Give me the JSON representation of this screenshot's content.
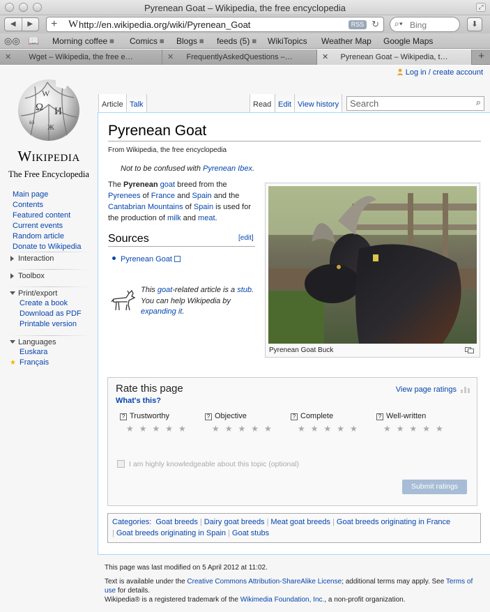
{
  "window": {
    "title": "Pyrenean Goat – Wikipedia, the free encyclopedia"
  },
  "toolbar": {
    "url": "http://en.wikipedia.org/wiki/Pyrenean_Goat",
    "rss_label": "RSS",
    "search_placeholder": "Bing"
  },
  "bookmarks": [
    {
      "label": "Morning coffee",
      "folder": true
    },
    {
      "label": "Comics",
      "folder": true
    },
    {
      "label": "Blogs",
      "folder": true
    },
    {
      "label": "feeds (5)",
      "folder": true
    },
    {
      "label": "WikiTopics",
      "folder": false
    },
    {
      "label": "Weather Map",
      "folder": false
    },
    {
      "label": "Google Maps",
      "folder": false
    }
  ],
  "tabs": [
    {
      "label": "Wget – Wikipedia, the free e…",
      "active": false
    },
    {
      "label": "FrequentlyAskedQuestions –…",
      "active": false
    },
    {
      "label": "Pyrenean Goat – Wikipedia, t…",
      "active": true
    }
  ],
  "logo": {
    "wordmark": "Wikipedia",
    "tagline": "The Free Encyclopedia"
  },
  "user": {
    "login_label": "Log in / create account"
  },
  "navigation": [
    "Main page",
    "Contents",
    "Featured content",
    "Current events",
    "Random article",
    "Donate to Wikipedia"
  ],
  "portlets": {
    "interaction": "Interaction",
    "toolbox": "Toolbox",
    "print_export": {
      "title": "Print/export",
      "items": [
        "Create a book",
        "Download as PDF",
        "Printable version"
      ]
    },
    "languages": {
      "title": "Languages",
      "items": [
        "Euskara",
        "Français"
      ]
    }
  },
  "page_tabs": {
    "article": "Article",
    "talk": "Talk",
    "read": "Read",
    "edit": "Edit",
    "history": "View history"
  },
  "search": {
    "placeholder": "Search"
  },
  "article": {
    "title": "Pyrenean Goat",
    "tagline": "From Wikipedia, the free encyclopedia",
    "hatnote_prefix": "Not to be confused with ",
    "hatnote_link": "Pyrenean Ibex",
    "hatnote_suffix": ".",
    "intro": {
      "t1": "The ",
      "b": "Pyrenean",
      "t2": " ",
      "l_goat": "goat",
      "t3": " breed from the ",
      "l_pyrenees": "Pyrenees",
      "t4": " of ",
      "l_france": "France",
      "t5": " and ",
      "l_spain": "Spain",
      "t6": " and the ",
      "l_cantabrian": "Cantabrian Mountains",
      "t7": " of ",
      "l_spain2": "Spain",
      "t8": " is used for the production of ",
      "l_milk": "milk",
      "t9": " and ",
      "l_meat": "meat",
      "t10": "."
    },
    "sources_heading": "Sources",
    "edit_label": "[edit]",
    "sources": [
      "Pyrenean Goat"
    ],
    "stub": {
      "t1": "This ",
      "l_goat": "goat",
      "t2": "-related article is a ",
      "l_stub": "stub",
      "t3": ". You can help Wikipedia by ",
      "l_expand": "expanding it",
      "t4": "."
    },
    "image_caption": "Pyrenean Goat Buck"
  },
  "rating": {
    "title": "Rate this page",
    "whats_this": "What's this?",
    "view_ratings": "View page ratings",
    "criteria": [
      "Trustworthy",
      "Objective",
      "Complete",
      "Well-written"
    ],
    "stars_glyph": "★★★★★",
    "knowledgeable": "I am highly knowledgeable about this topic (optional)",
    "submit": "Submit ratings"
  },
  "categories": {
    "label": "Categories",
    "items": [
      "Goat breeds",
      "Dairy goat breeds",
      "Meat goat breeds",
      "Goat breeds originating in France",
      "Goat breeds originating in Spain",
      "Goat stubs"
    ]
  },
  "footer": {
    "modified": "This page was last modified on 5 April 2012 at 11:02.",
    "license_t1": "Text is available under the ",
    "license_link": "Creative Commons Attribution-ShareAlike License",
    "license_t2": "; additional terms may apply. See ",
    "terms_link": "Terms of use",
    "license_t3": " for details.",
    "trademark_t1": "Wikipedia® is a registered trademark of the ",
    "trademark_link": "Wikimedia Foundation, Inc.",
    "trademark_t2": ", a non-profit organization."
  }
}
